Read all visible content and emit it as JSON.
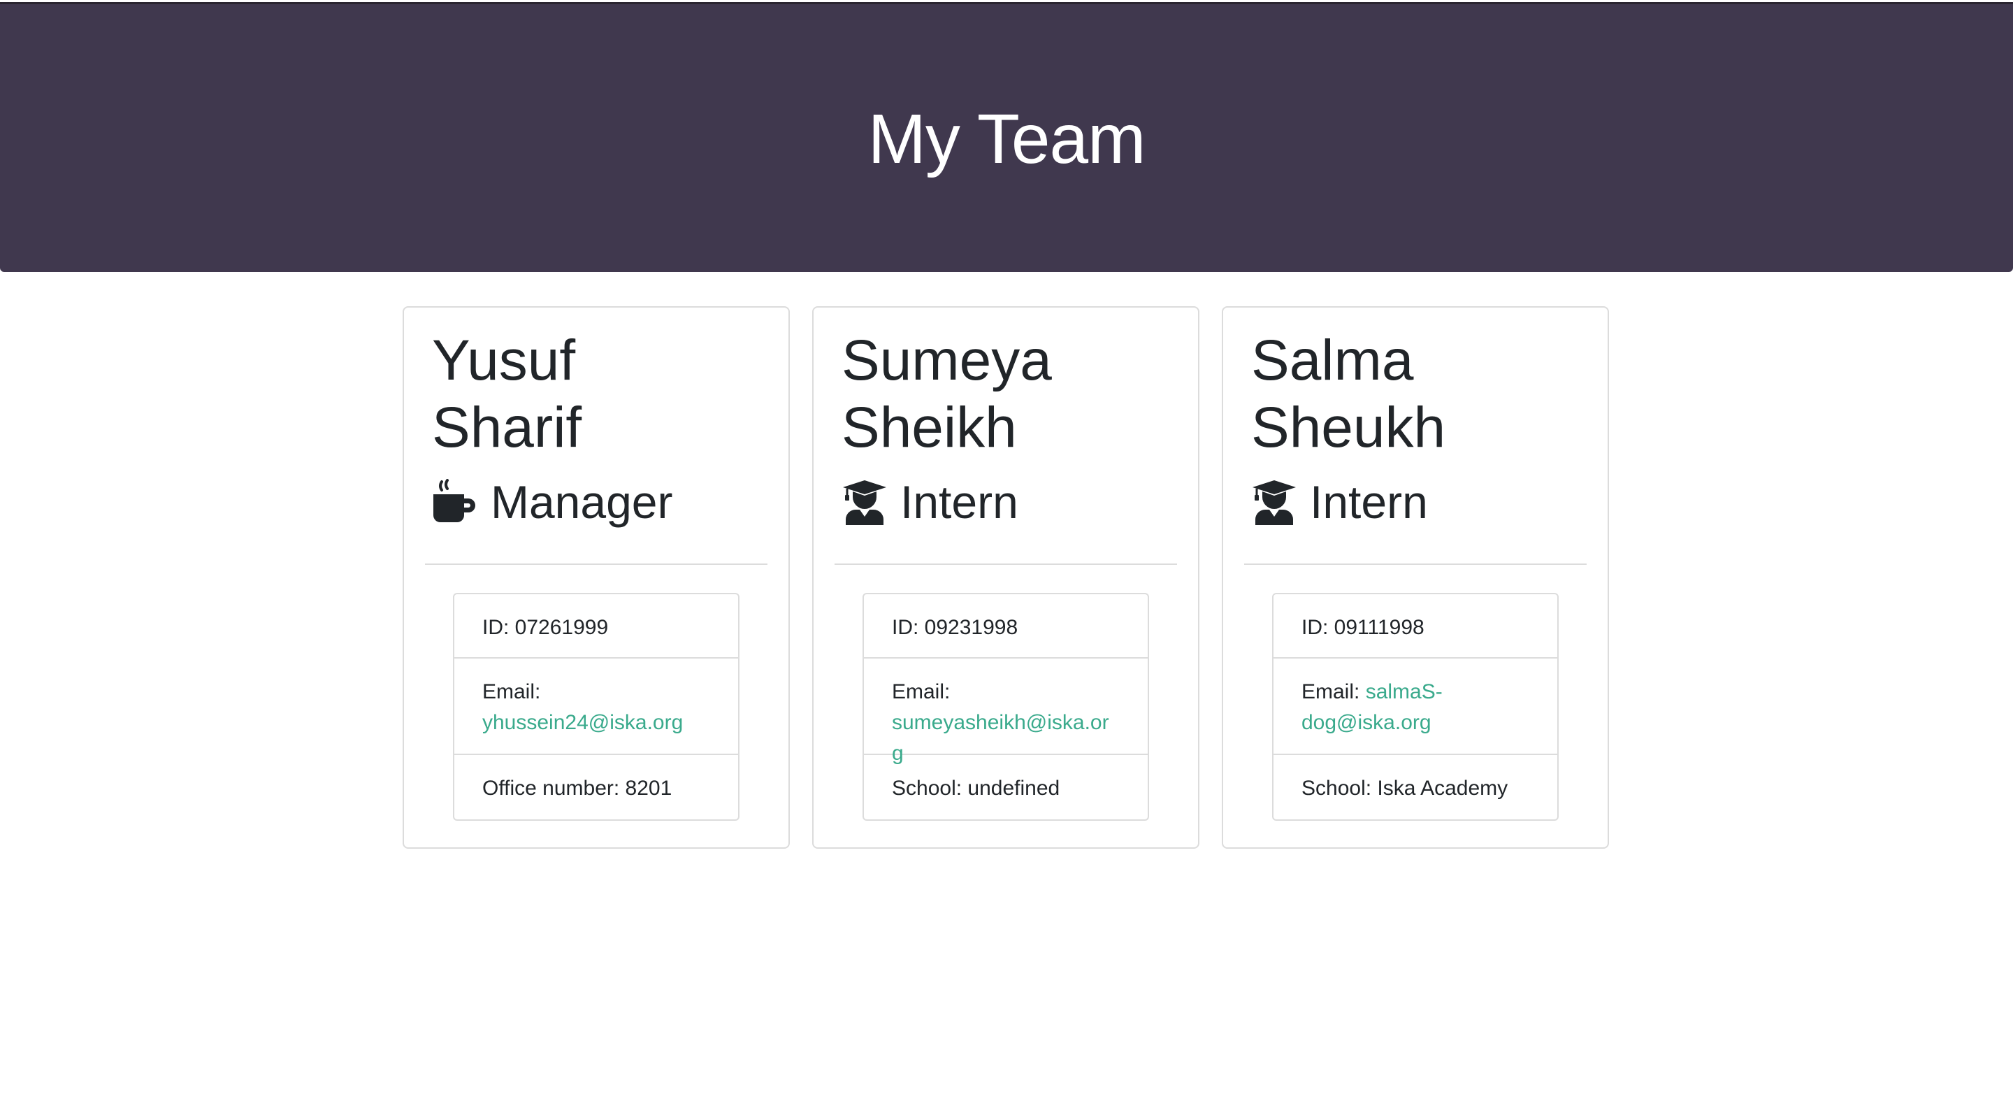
{
  "header": {
    "title": "My Team"
  },
  "members": [
    {
      "first_name": "Yusuf",
      "last_name": "Sharif",
      "role": "Manager",
      "role_icon": "coffee-mug-icon",
      "id_label": "ID: 07261999",
      "email_label": "Email:",
      "email": "yhussein24@iska.org",
      "extra_label": "Office number: 8201"
    },
    {
      "first_name": "Sumeya",
      "last_name": "Sheikh",
      "role": "Intern",
      "role_icon": "graduate-icon",
      "id_label": "ID: 09231998",
      "email_label": "Email:",
      "email": "sumeyasheikh@iska.org",
      "extra_label": "School: undefined"
    },
    {
      "first_name": "Salma",
      "last_name": "Sheukh",
      "role": "Intern",
      "role_icon": "graduate-icon",
      "id_label": "ID: 09111998",
      "email_label": "Email:",
      "email": "salmaS-dog@iska.org",
      "extra_label": "School: Iska Academy"
    }
  ],
  "colors": {
    "header_bg": "#40384e",
    "link": "#3aaa8c"
  }
}
